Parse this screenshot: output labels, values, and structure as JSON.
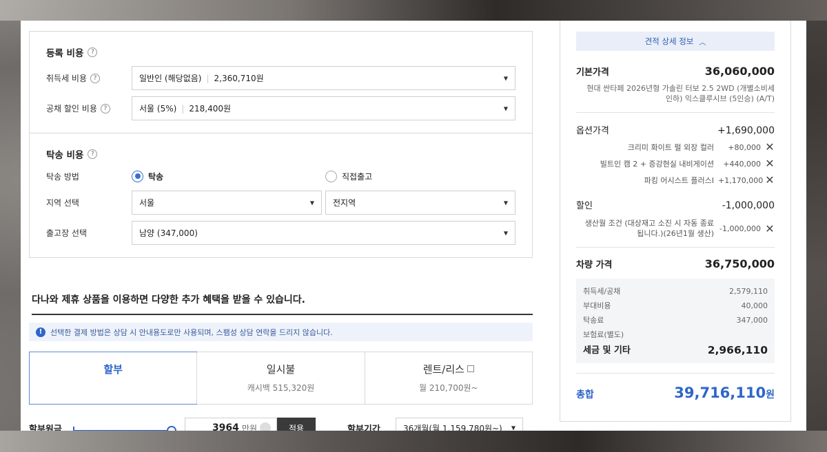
{
  "registration": {
    "title": "등록 비용",
    "acquisition_tax": {
      "label": "취득세 비용",
      "value": "일반인 (해당없음)",
      "amount": "2,360,710원"
    },
    "bond_discount": {
      "label": "공채 할인 비용",
      "value": "서울 (5%)",
      "amount": "218,400원"
    }
  },
  "delivery": {
    "title": "탁송 비용",
    "method_label": "탁송 방법",
    "method_option_1": "탁송",
    "method_option_2": "직접출고",
    "region_label": "지역 선택",
    "region_value": "서울",
    "region_sub_value": "전지역",
    "depot_label": "출고장 선택",
    "depot_value": "남양 (347,000)"
  },
  "promo": {
    "title": "다나와 제휴 상품을 이용하면 다양한 추가 혜택을 받을 수 있습니다.",
    "notice": "선택한 결제 방법은 상담 시 안내용도로만 사용되며, 스팸성 상담 연락을 드리지 않습니다.",
    "tabs": [
      {
        "title": "할부",
        "sub": ""
      },
      {
        "title": "일시불",
        "sub": "캐시백 515,320원"
      },
      {
        "title": "렌트/리스",
        "sub": "월 210,700원~"
      }
    ]
  },
  "installment": {
    "principal_label": "할부원금",
    "principal_value": "3964",
    "principal_unit": "만원",
    "apply_label": "적용",
    "period_label": "할부기간",
    "period_value": "36개월(월 1,159,780원~)"
  },
  "summary": {
    "toggle_label": "견적 상세 정보",
    "base_price_label": "기본가격",
    "base_price": "36,060,000",
    "model_desc": "현대 싼타페 2026년형 가솔린 터보 2.5 2WD (개별소비세 인하) 익스클루시브 (5인승) (A/T)",
    "options_label": "옵션가격",
    "options_total": "+1,690,000",
    "options": [
      {
        "name": "크리미 화이트 펄 외장 컬러",
        "amount": "+80,000"
      },
      {
        "name": "빌트인 캠 2 + 증강현실 내비게이션",
        "amount": "+440,000"
      },
      {
        "name": "파킹 어시스트 플러스I",
        "amount": "+1,170,000"
      }
    ],
    "discount_label": "할인",
    "discount_total": "-1,000,000",
    "discounts": [
      {
        "name": "생산월 조건 (대상재고 소진 시 자동 종료됩니다.)(26년1월 생산)",
        "amount": "-1,000,000"
      }
    ],
    "vehicle_price_label": "차량 가격",
    "vehicle_price": "36,750,000",
    "tax_items": [
      {
        "name": "취득세/공채",
        "amount": "2,579,110"
      },
      {
        "name": "부대비용",
        "amount": "40,000"
      },
      {
        "name": "탁송료",
        "amount": "347,000"
      },
      {
        "name": "보험료(별도)",
        "amount": ""
      }
    ],
    "tax_total_label": "세금 및 기타",
    "tax_total": "2,966,110",
    "grand_label": "총합",
    "grand_total": "39,716,110",
    "grand_unit": "원"
  }
}
